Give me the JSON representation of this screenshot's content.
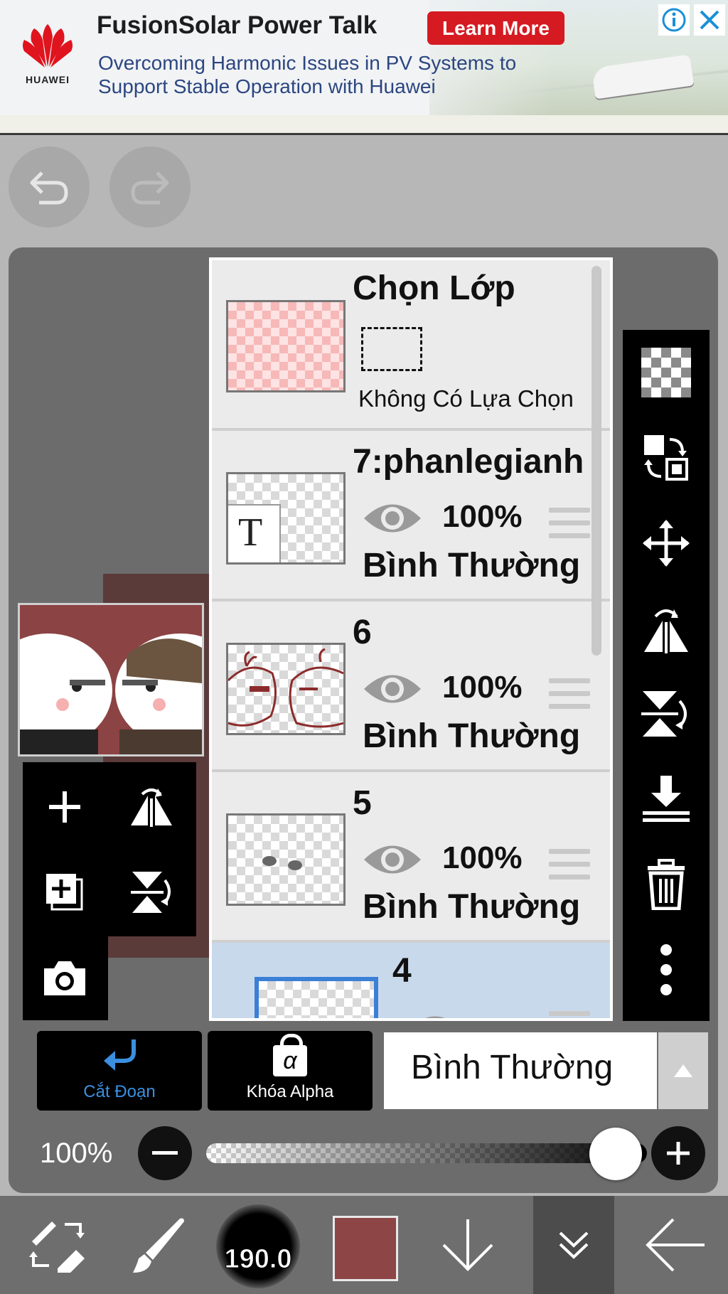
{
  "ad": {
    "title": "FusionSolar Power Talk",
    "button": "Learn More",
    "subtitle": "Overcoming Harmonic Issues in PV Systems to Support Stable Operation with Huawei",
    "brand": "HUAWEI",
    "info_icon": "info-icon",
    "close_icon": "close-icon"
  },
  "history": {
    "undo_icon": "undo-icon",
    "redo_icon": "redo-icon"
  },
  "layers": {
    "selection": {
      "title": "Chọn Lớp",
      "status": "Không Có Lựa Chọn"
    },
    "items": [
      {
        "name": "7:phanlegianh",
        "opacity": "100%",
        "blend": "Bình Thường",
        "type": "text"
      },
      {
        "name": "6",
        "opacity": "100%",
        "blend": "Bình Thường",
        "type": "image"
      },
      {
        "name": "5",
        "opacity": "100%",
        "blend": "Bình Thường",
        "type": "image"
      },
      {
        "name": "4",
        "opacity": "",
        "blend": "",
        "type": "image",
        "selected": true
      }
    ]
  },
  "right_tools": [
    "transparency-icon",
    "swap-layer-icon",
    "move-icon",
    "flip-horizontal-icon",
    "flip-vertical-icon",
    "merge-down-icon",
    "trash-icon",
    "more-icon"
  ],
  "left_tools": [
    "add-layer-icon",
    "flip-horizontal-icon",
    "duplicate-layer-icon",
    "flip-vertical-icon",
    "camera-icon"
  ],
  "bottom_controls": {
    "clip_label": "Cắt Đoạn",
    "alpha_label": "Khóa Alpha",
    "alpha_symbol": "α",
    "blend_mode": "Bình Thường",
    "opacity_label": "100%",
    "opacity_value": 1.0
  },
  "toolbar": {
    "brush_size": "190.0",
    "color": "#8d4545"
  },
  "colors": {
    "accent_blue": "#3b8fe0",
    "ad_red": "#d61a21"
  }
}
